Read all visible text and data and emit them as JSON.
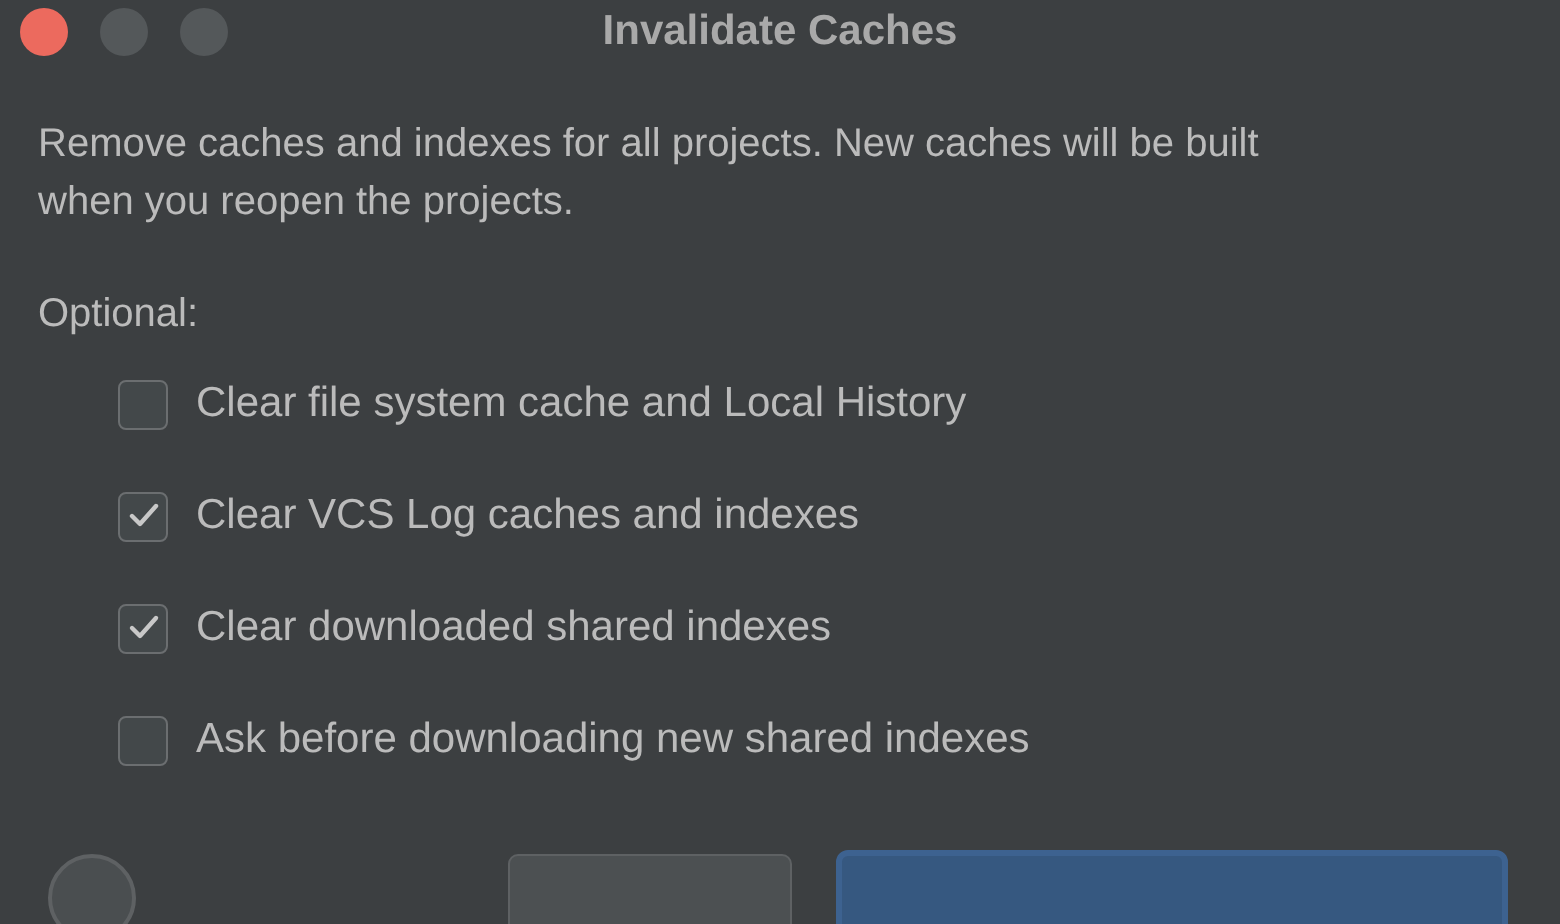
{
  "window": {
    "title": "Invalidate Caches"
  },
  "description": "Remove caches and indexes for all projects. New caches will be built when you reopen the projects.",
  "optional_label": "Optional:",
  "options": [
    {
      "label": "Clear file system cache and Local History",
      "checked": false
    },
    {
      "label": "Clear VCS Log caches and indexes",
      "checked": true
    },
    {
      "label": "Clear downloaded shared indexes",
      "checked": true
    },
    {
      "label": "Ask before downloading new shared indexes",
      "checked": false
    }
  ]
}
